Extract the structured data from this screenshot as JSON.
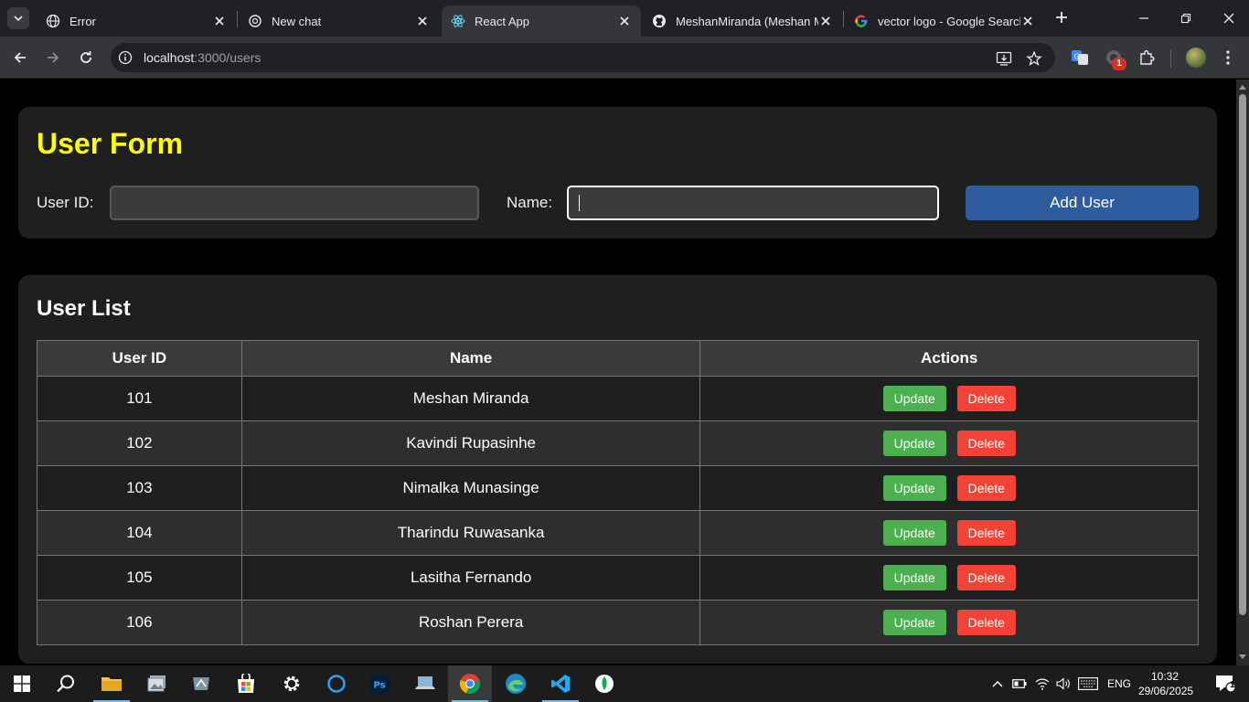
{
  "browser": {
    "tabs": [
      {
        "title": "Error",
        "icon": "globe-icon",
        "active": false
      },
      {
        "title": "New chat",
        "icon": "openai-icon",
        "active": false
      },
      {
        "title": "React App",
        "icon": "react-icon",
        "active": true
      },
      {
        "title": "MeshanMiranda (Meshan M",
        "icon": "github-icon",
        "active": false
      },
      {
        "title": "vector logo - Google Search",
        "icon": "google-icon",
        "active": false
      }
    ],
    "url_host": "localhost",
    "url_path": ":3000/users",
    "extension_badge": "1"
  },
  "form": {
    "title": "User Form",
    "user_id_label": "User ID:",
    "user_id_value": "",
    "name_label": "Name:",
    "name_value": "",
    "add_button": "Add User"
  },
  "list": {
    "title": "User List",
    "columns": [
      "User ID",
      "Name",
      "Actions"
    ],
    "update_label": "Update",
    "delete_label": "Delete",
    "rows": [
      {
        "id": "101",
        "name": "Meshan Miranda"
      },
      {
        "id": "102",
        "name": "Kavindi Rupasinhe"
      },
      {
        "id": "103",
        "name": "Nimalka Munasinge"
      },
      {
        "id": "104",
        "name": "Tharindu Ruwasanka"
      },
      {
        "id": "105",
        "name": "Lasitha Fernando"
      },
      {
        "id": "106",
        "name": "Roshan Perera"
      }
    ]
  },
  "taskbar": {
    "language": "ENG",
    "time": "10:32",
    "date": "29/06/2025",
    "notification_count": "1"
  },
  "colors": {
    "title_yellow": "#ffff00",
    "add_button": "#2e5c9e",
    "update_button": "#4caf50",
    "delete_button": "#f44336"
  }
}
